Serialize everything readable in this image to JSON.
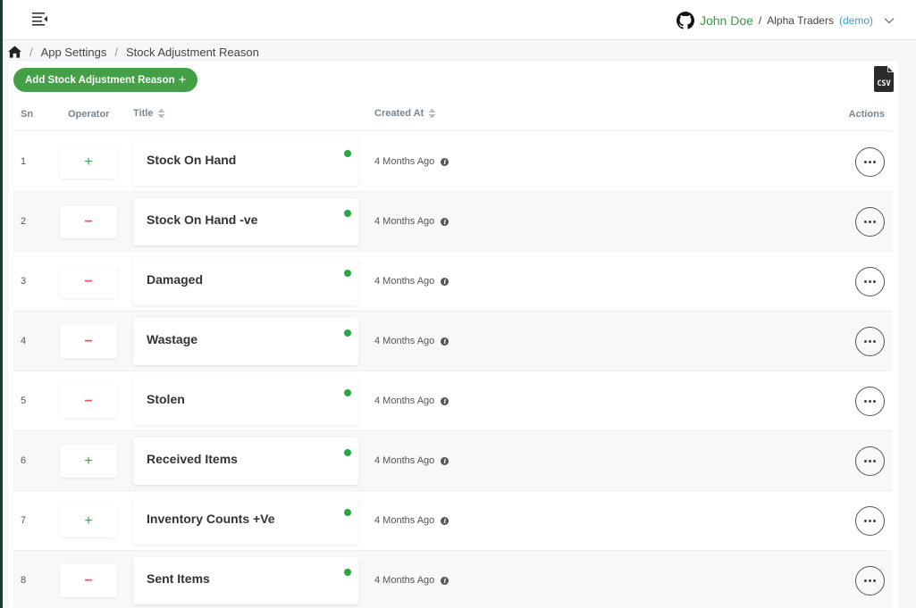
{
  "topbar": {
    "user_name": "John Doe",
    "separator": "/",
    "company": "Alpha Traders",
    "mode": "(demo)"
  },
  "breadcrumb": {
    "items": [
      "App Settings",
      "Stock Adjustment Reason"
    ],
    "separator": "/"
  },
  "toolbar": {
    "add_label": "Add Stock Adjustment Reason",
    "add_icon": "+",
    "export_label": "CSV"
  },
  "table": {
    "headers": {
      "sn": "Sn",
      "operator": "Operator",
      "title": "Title",
      "created_at": "Created At",
      "actions": "Actions"
    },
    "rows": [
      {
        "sn": "1",
        "operator": "+",
        "title": "Stock On Hand",
        "created_at": "4 Months Ago",
        "active": true
      },
      {
        "sn": "2",
        "operator": "−",
        "title": "Stock On Hand -ve",
        "created_at": "4 Months Ago",
        "active": true
      },
      {
        "sn": "3",
        "operator": "−",
        "title": "Damaged",
        "created_at": "4 Months Ago",
        "active": true
      },
      {
        "sn": "4",
        "operator": "−",
        "title": "Wastage",
        "created_at": "4 Months Ago",
        "active": true
      },
      {
        "sn": "5",
        "operator": "−",
        "title": "Stolen",
        "created_at": "4 Months Ago",
        "active": true
      },
      {
        "sn": "6",
        "operator": "+",
        "title": "Received Items",
        "created_at": "4 Months Ago",
        "active": true
      },
      {
        "sn": "7",
        "operator": "+",
        "title": "Inventory Counts +Ve",
        "created_at": "4 Months Ago",
        "active": true
      },
      {
        "sn": "8",
        "operator": "−",
        "title": "Sent Items",
        "created_at": "4 Months Ago",
        "active": true
      }
    ]
  },
  "colors": {
    "brand_green": "#43a047",
    "plus": "#43a047",
    "minus": "#e05a64",
    "status_active": "#28a745",
    "demo_link": "#3ca0c7"
  }
}
